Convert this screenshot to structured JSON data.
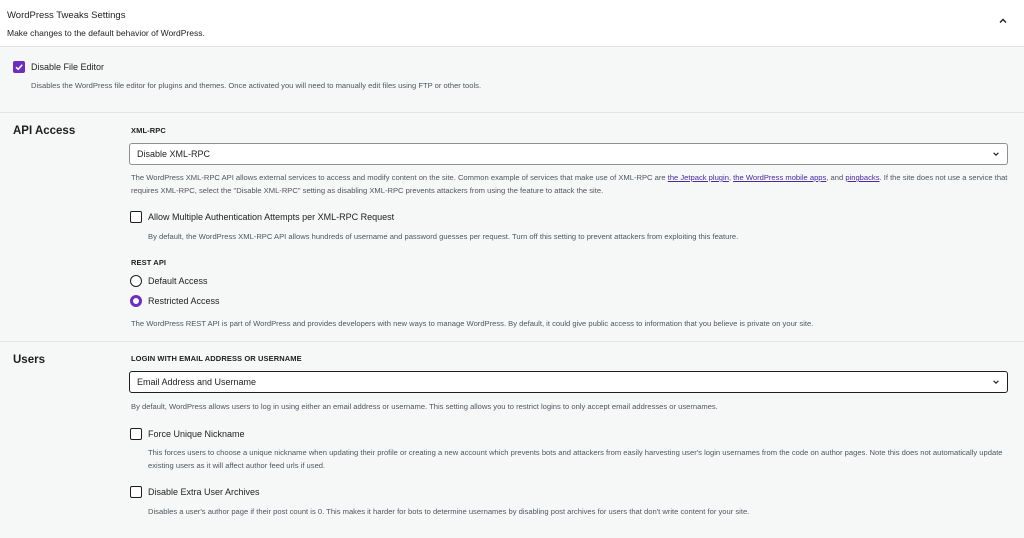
{
  "header": {
    "title": "WordPress Tweaks Settings",
    "subtitle": "Make changes to the default behavior of WordPress."
  },
  "file_editor": {
    "label": "Disable File Editor",
    "checked": true,
    "help": "Disables the WordPress file editor for plugins and themes. Once activated you will need to manually edit files using FTP or other tools."
  },
  "api_access": {
    "heading": "API Access",
    "xmlrpc": {
      "label": "XML-RPC",
      "selected": "Disable XML-RPC",
      "help_before": "The WordPress XML-RPC API allows external services to access and modify content on the site. Common example of services that make use of XML-RPC are ",
      "link1": "the Jetpack plugin",
      "sep1": ", ",
      "link2": "the WordPress mobile apps",
      "sep2": ", and ",
      "link3": "pingbacks",
      "help_after": ". If the site does not use a service that requires XML-RPC, select the \"Disable XML-RPC\" setting as disabling XML-RPC prevents attackers from using the feature to attack the site."
    },
    "multi_auth": {
      "label": "Allow Multiple Authentication Attempts per XML-RPC Request",
      "checked": false,
      "help": "By default, the WordPress XML-RPC API allows hundreds of username and password guesses per request. Turn off this setting to prevent attackers from exploiting this feature."
    },
    "rest": {
      "label": "REST API",
      "options": [
        "Default Access",
        "Restricted Access"
      ],
      "selected": "Restricted Access",
      "help": "The WordPress REST API is part of WordPress and provides developers with new ways to manage WordPress. By default, it could give public access to information that you believe is private on your site."
    }
  },
  "users": {
    "heading": "Users",
    "login": {
      "label": "LOGIN WITH EMAIL ADDRESS OR USERNAME",
      "selected": "Email Address and Username",
      "help": "By default, WordPress allows users to log in using either an email address or username. This setting allows you to restrict logins to only accept email addresses or usernames."
    },
    "unique_nick": {
      "label": "Force Unique Nickname",
      "checked": false,
      "help": "This forces users to choose a unique nickname when updating their profile or creating a new account which prevents bots and attackers from easily harvesting user's login usernames from the code on author pages. Note this does not automatically update existing users as it will affect author feed urls if used."
    },
    "archives": {
      "label": "Disable Extra User Archives",
      "checked": false,
      "help": "Disables a user's author page if their post count is 0. This makes it harder for bots to determine usernames by disabling post archives for users that don't write content for your site."
    }
  },
  "colors": {
    "accent": "#6c2ebe",
    "link": "#4a2aa0",
    "help_text": "#50575e",
    "background": "#f6f7f7"
  },
  "icons": {
    "collapse": "chevron-up-icon",
    "dropdown": "chevron-down-icon",
    "check": "check-icon"
  }
}
